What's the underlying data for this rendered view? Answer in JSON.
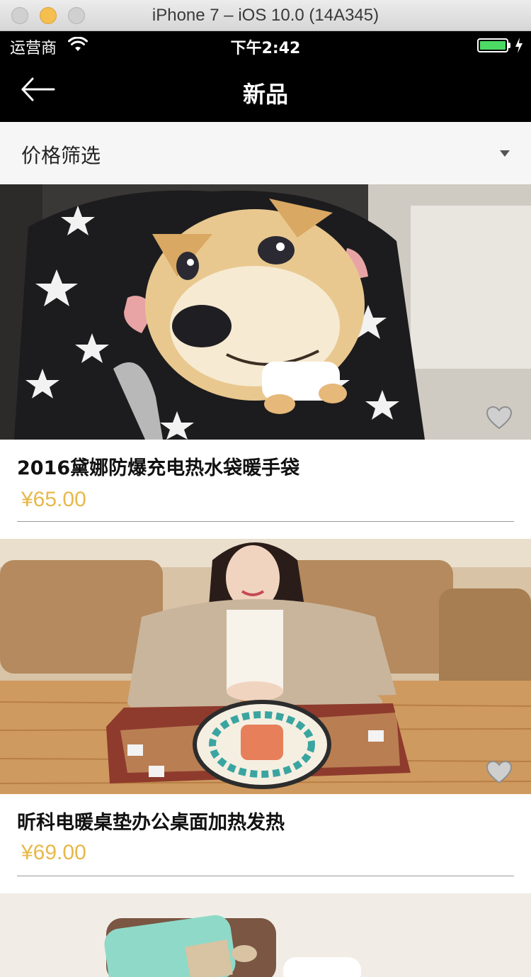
{
  "window": {
    "title": "iPhone 7 – iOS 10.0 (14A345)"
  },
  "statusbar": {
    "carrier": "运营商",
    "time": "下午2:42",
    "battery_level": 1.0,
    "wifi_icon": "wifi-icon",
    "charging_icon": "charging-bolt-icon"
  },
  "navbar": {
    "title": "新品",
    "back_icon": "back-arrow-icon"
  },
  "filter": {
    "label": "价格筛选",
    "caret_icon": "chevron-down-icon"
  },
  "colors": {
    "nav_background": "#000000",
    "price": "#e8b84a",
    "filter_background": "#f6f6f6",
    "battery": "#4cd964",
    "favorite": "#cfcfcf"
  },
  "products": [
    {
      "name": "2016黛娜防爆充电热水袋暖手袋",
      "price": "¥65.00",
      "image": "doge-pillow-photo"
    },
    {
      "name": "昕科电暖桌垫办公桌面加热发热",
      "price": "¥69.00",
      "image": "woman-desk-mat-photo"
    },
    {
      "name": "",
      "price": "",
      "image": "phone-cases-photo"
    }
  ]
}
